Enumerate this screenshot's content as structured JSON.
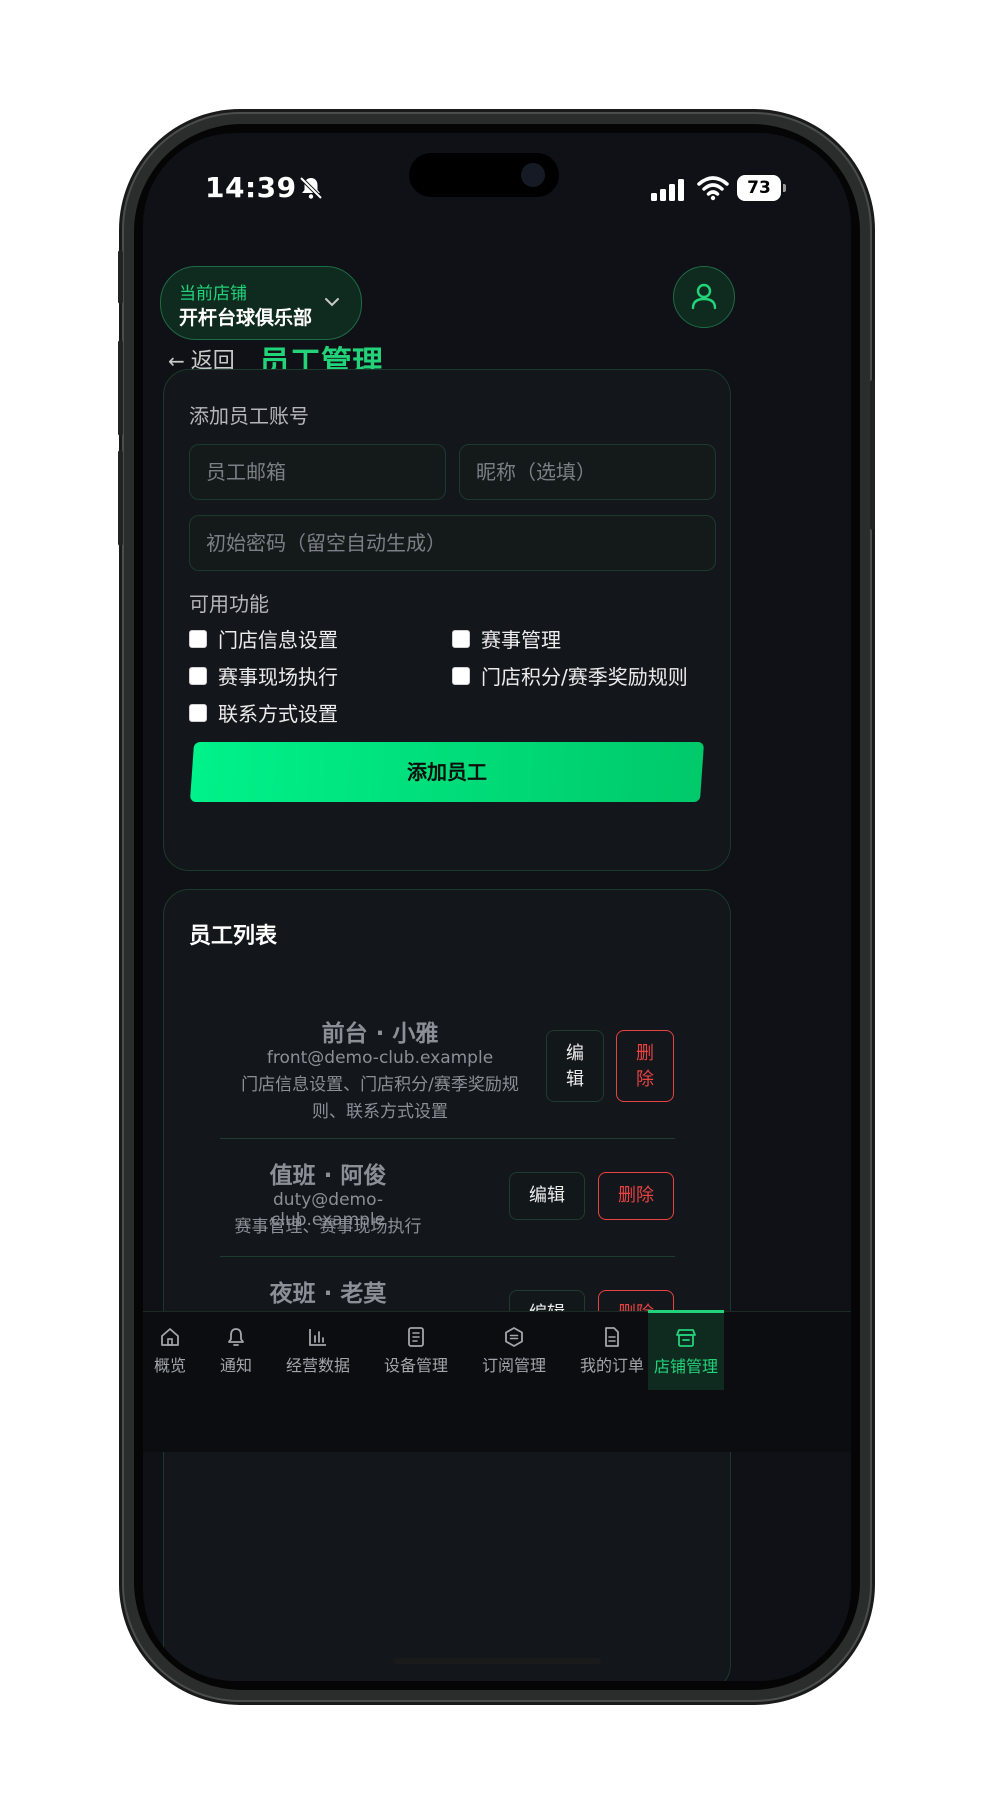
{
  "status": {
    "time": "14:39",
    "battery": "73"
  },
  "header": {
    "store_label": "当前店铺",
    "store_name": "开杆台球俱乐部",
    "back_label": "返回",
    "page_title": "员工管理"
  },
  "add_form": {
    "section_title": "添加员工账号",
    "email_placeholder": "员工邮箱",
    "nickname_placeholder": "昵称（选填）",
    "password_placeholder": "初始密码（留空自动生成）",
    "features_label": "可用功能",
    "features": [
      {
        "label": "门店信息设置",
        "checked": false
      },
      {
        "label": "赛事管理",
        "checked": false
      },
      {
        "label": "赛事现场执行",
        "checked": false
      },
      {
        "label": "门店积分/赛季奖励规则",
        "checked": false
      },
      {
        "label": "联系方式设置",
        "checked": false
      }
    ],
    "submit_label": "添加员工"
  },
  "staff_list": {
    "title": "员工列表",
    "employees": [
      {
        "name": "前台 · 小雅",
        "email": "front@demo-club.example",
        "permissions": "门店信息设置、门店积分/赛季奖励规则、联系方式设置",
        "edit_label": "编辑",
        "delete_label": "删除"
      },
      {
        "name": "值班 · 阿俊",
        "email": "duty@demo-club.example",
        "permissions": "赛事管理、赛事现场执行",
        "edit_label": "编辑",
        "delete_label": "删除"
      },
      {
        "name": "夜班 · 老莫",
        "email": "",
        "permissions": "",
        "edit_label": "编辑",
        "delete_label": "删除"
      }
    ]
  },
  "tabbar": {
    "items": [
      {
        "label": "概览",
        "icon": "home-icon"
      },
      {
        "label": "通知",
        "icon": "bell-icon"
      },
      {
        "label": "经营数据",
        "icon": "bar-chart-icon"
      },
      {
        "label": "设备管理",
        "icon": "device-icon"
      },
      {
        "label": "订阅管理",
        "icon": "subscription-icon"
      },
      {
        "label": "我的订单",
        "icon": "order-icon"
      },
      {
        "label": "店铺管理",
        "icon": "store-icon",
        "active": true
      }
    ]
  },
  "colors": {
    "accent": "#22d37a",
    "danger": "#e84343",
    "background": "#0f1116",
    "card": "#13161b"
  }
}
